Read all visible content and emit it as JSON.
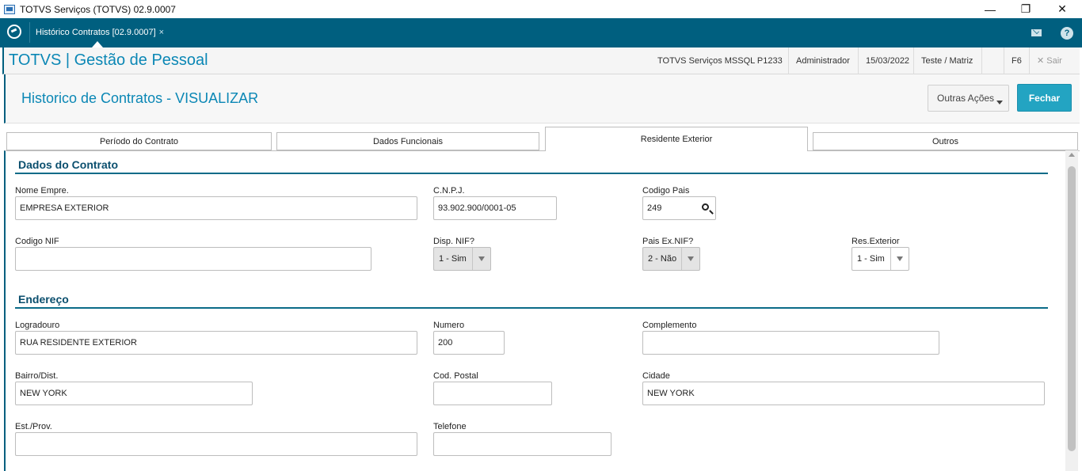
{
  "window": {
    "title": "TOTVS Serviços (TOTVS) 02.9.0007",
    "minimize": "—",
    "restore": "❐",
    "close": "✕"
  },
  "tabbar": {
    "program_tab": "Histórico Contratos [02.9.0007]",
    "program_tab_close": "×",
    "help": "?"
  },
  "module": {
    "title": "TOTVS | Gestão de Pessoal",
    "environment": "TOTVS Serviços MSSQL P1233",
    "user": "Administrador",
    "date": "15/03/2022",
    "company": "Teste / Matriz",
    "shortcut": "F6",
    "exit": "Sair"
  },
  "page": {
    "title": "Historico de Contratos - VISUALIZAR",
    "other_actions": "Outras Ações",
    "close": "Fechar"
  },
  "tabs": [
    {
      "label": "Período do Contrato",
      "active": false
    },
    {
      "label": "Dados Funcionais",
      "active": false
    },
    {
      "label": "Residente Exterior",
      "active": true
    },
    {
      "label": "Outros",
      "active": false
    }
  ],
  "sections": {
    "contract": "Dados do Contrato",
    "address": "Endereço"
  },
  "fields": {
    "nome_empre": {
      "label": "Nome Empre.",
      "value": "EMPRESA EXTERIOR"
    },
    "cnpj": {
      "label": "C.N.P.J.",
      "value": "93.902.900/0001-05"
    },
    "codigo_pais": {
      "label": "Codigo Pais",
      "value": "249"
    },
    "codigo_nif": {
      "label": "Codigo NIF",
      "value": ""
    },
    "disp_nif": {
      "label": "Disp. NIF?",
      "value": "1 - Sim"
    },
    "pais_ex_nif": {
      "label": "Pais Ex.NIF?",
      "value": "2 - Não"
    },
    "res_exterior": {
      "label": "Res.Exterior",
      "value": "1 - Sim"
    },
    "logradouro": {
      "label": "Logradouro",
      "value": "RUA RESIDENTE EXTERIOR"
    },
    "numero": {
      "label": "Numero",
      "value": "200"
    },
    "complemento": {
      "label": "Complemento",
      "value": ""
    },
    "bairro": {
      "label": "Bairro/Dist.",
      "value": "NEW YORK"
    },
    "cod_postal": {
      "label": "Cod. Postal",
      "value": ""
    },
    "cidade": {
      "label": "Cidade",
      "value": "NEW YORK"
    },
    "est_prov": {
      "label": "Est./Prov.",
      "value": ""
    },
    "telefone": {
      "label": "Telefone",
      "value": ""
    }
  },
  "colors": {
    "brand_teal": "#005f7f",
    "accent_blue": "#0b87b5",
    "primary_button": "#23a4c2"
  },
  "icons": [
    "app-icon",
    "totvs-logo-icon",
    "mail-icon",
    "help-icon",
    "search-icon",
    "close-icon",
    "chevron-down-icon"
  ]
}
